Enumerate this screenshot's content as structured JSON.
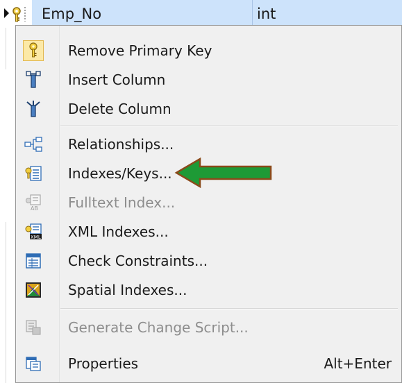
{
  "grid_row": {
    "column_name": "Emp_No",
    "data_type": "int"
  },
  "menu": {
    "items": [
      {
        "label": "Remove Primary Key",
        "icon": "key-icon",
        "enabled": true,
        "checked": true
      },
      {
        "label": "Insert Column",
        "icon": "insert-column-icon",
        "enabled": true
      },
      {
        "label": "Delete Column",
        "icon": "delete-column-icon",
        "enabled": true
      },
      {
        "label": "Relationships...",
        "icon": "relationships-icon",
        "enabled": true
      },
      {
        "label": "Indexes/Keys...",
        "icon": "indexes-keys-icon",
        "enabled": true
      },
      {
        "label": "Fulltext Index...",
        "icon": "fulltext-index-icon",
        "enabled": false
      },
      {
        "label": "XML Indexes...",
        "icon": "xml-indexes-icon",
        "enabled": true
      },
      {
        "label": "Check Constraints...",
        "icon": "check-constraints-icon",
        "enabled": true
      },
      {
        "label": "Spatial Indexes...",
        "icon": "spatial-indexes-icon",
        "enabled": true
      },
      {
        "label": "Generate Change Script...",
        "icon": "generate-script-icon",
        "enabled": false
      },
      {
        "label": "Properties",
        "icon": "properties-icon",
        "enabled": true,
        "shortcut": "Alt+Enter"
      }
    ]
  },
  "colors": {
    "row_highlight": "#cde3fb",
    "arrow_fill": "#1e9a36",
    "arrow_outline": "#8a4a1a"
  }
}
